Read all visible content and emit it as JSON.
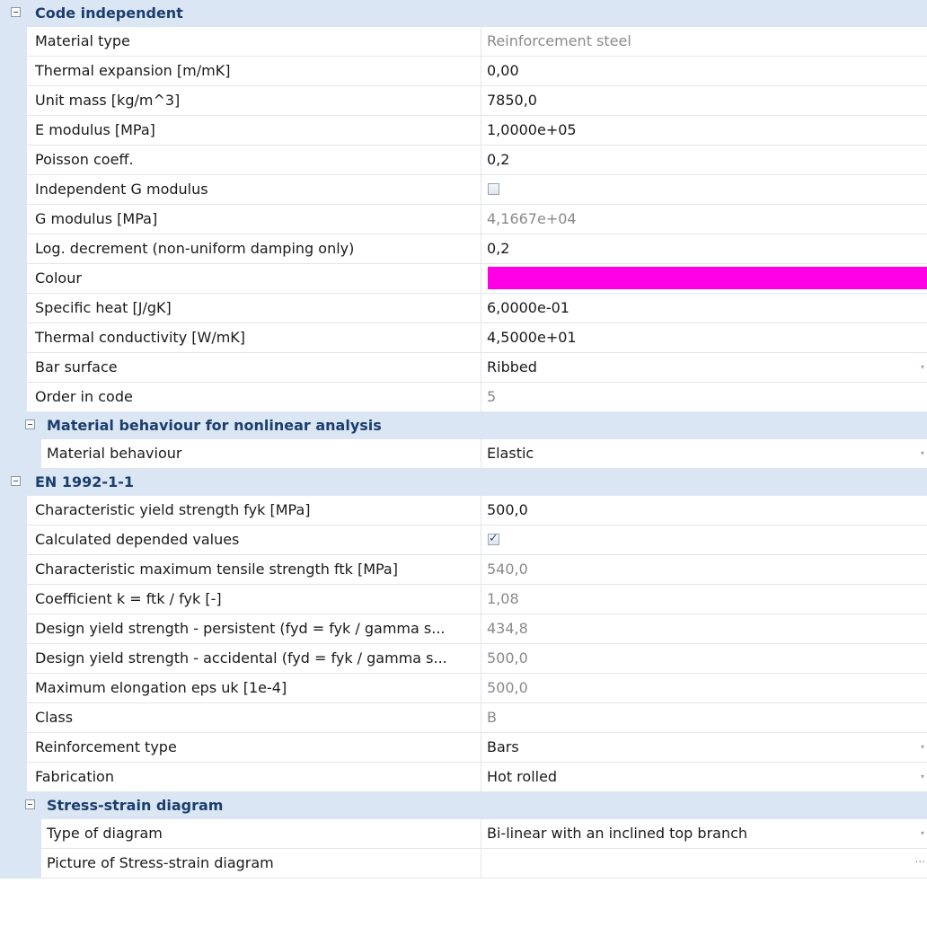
{
  "categories": {
    "code_independent": "Code independent",
    "nonlinear": "Material behaviour for nonlinear analysis",
    "en1992": "EN 1992-1-1",
    "stress_strain": "Stress-strain diagram"
  },
  "code_independent": [
    {
      "name": "Material type",
      "value": "Reinforcement steel"
    },
    {
      "name": "Thermal expansion  [m/mK]",
      "value": "0,00"
    },
    {
      "name": "Unit mass [kg/m^3]",
      "value": "7850,0"
    },
    {
      "name": "E modulus [MPa]",
      "value": "1,0000e+05"
    },
    {
      "name": "Poisson coeff.",
      "value": "0,2"
    },
    {
      "name": "Independent G modulus",
      "value": false
    },
    {
      "name": "G modulus [MPa]",
      "value": "4,1667e+04"
    },
    {
      "name": "Log. decrement (non-uniform damping only)",
      "value": "0,2"
    },
    {
      "name": "Colour",
      "color": "#ff00e6"
    },
    {
      "name": "Specific heat [J/gK]",
      "value": "6,0000e-01"
    },
    {
      "name": "Thermal conductivity [W/mK]",
      "value": "4,5000e+01"
    },
    {
      "name": "Bar surface",
      "value": "Ribbed"
    },
    {
      "name": "Order in code",
      "value": "5"
    }
  ],
  "nonlinear": [
    {
      "name": "Material behaviour",
      "value": "Elastic"
    }
  ],
  "en1992": [
    {
      "name": "Characteristic yield strength fyk [MPa]",
      "value": "500,0"
    },
    {
      "name": "Calculated depended values",
      "value": true
    },
    {
      "name": "Characteristic maximum tensile strength ftk [MPa]",
      "value": "540,0"
    },
    {
      "name": "Coefficient k = ftk / fyk [-]",
      "value": "1,08"
    },
    {
      "name": "Design yield strength - persistent (fyd = fyk / gamma s...",
      "value": "434,8"
    },
    {
      "name": "Design yield strength - accidental (fyd = fyk / gamma s...",
      "value": "500,0"
    },
    {
      "name": "Maximum elongation eps uk [1e-4]",
      "value": "500,0"
    },
    {
      "name": "Class",
      "value": "B"
    },
    {
      "name": "Reinforcement type",
      "value": "Bars"
    },
    {
      "name": "Fabrication",
      "value": "Hot rolled"
    }
  ],
  "stress_strain": [
    {
      "name": "Type of diagram",
      "value": "Bi-linear with an inclined top branch"
    },
    {
      "name": "Picture of Stress-strain diagram",
      "value": ""
    }
  ],
  "icons": {
    "dropdown": "▾",
    "ellipsis": "...",
    "check": "✓"
  }
}
